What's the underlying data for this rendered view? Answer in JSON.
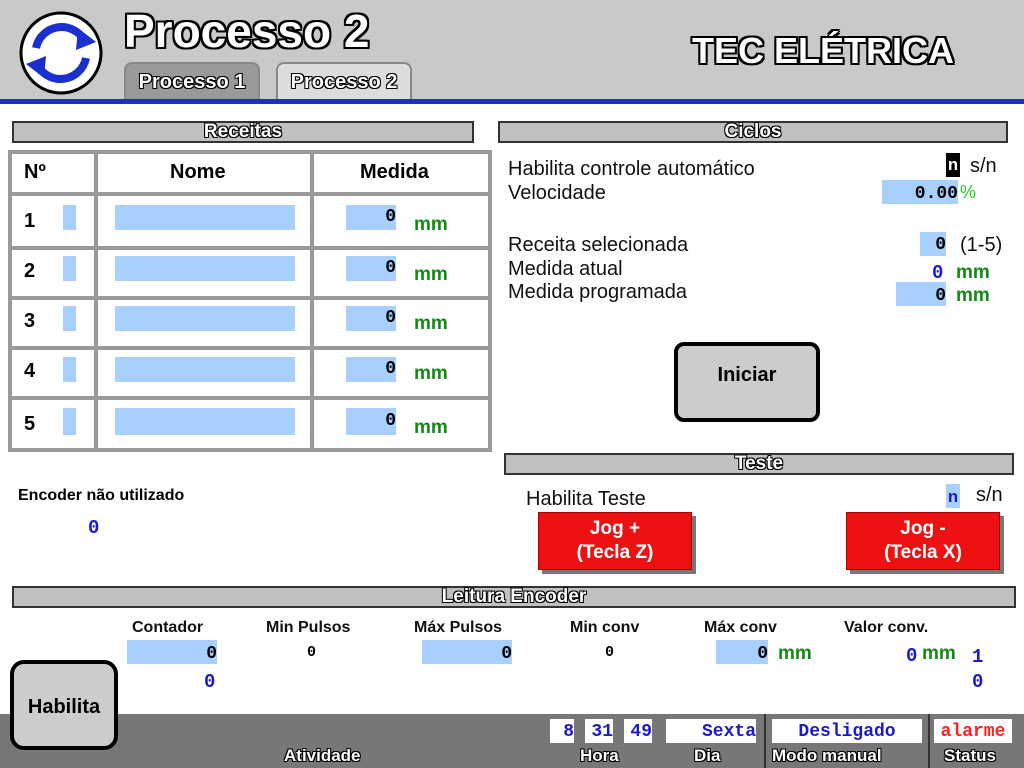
{
  "header": {
    "title": "Processo 2",
    "company": "TEC ELÉTRICA",
    "tabs": [
      {
        "label": "Processo 1"
      },
      {
        "label": "Processo 2"
      }
    ]
  },
  "receitas": {
    "section_title": "Receitas",
    "col_num": "Nº",
    "col_nome": "Nome",
    "col_medida": "Medida",
    "unit": "mm",
    "rows": [
      {
        "num": "1",
        "medida": "0"
      },
      {
        "num": "2",
        "medida": "0"
      },
      {
        "num": "3",
        "medida": "0"
      },
      {
        "num": "4",
        "medida": "0"
      },
      {
        "num": "5",
        "medida": "0"
      }
    ]
  },
  "ciclos": {
    "section_title": "Ciclos",
    "habilita_label": "Habilita controle automático",
    "habilita_value": "n",
    "habilita_suffix": "s/n",
    "velocidade_label": "Velocidade",
    "velocidade_value": "0.00",
    "velocidade_unit": "%",
    "receita_label": "Receita selecionada",
    "receita_value": "0",
    "receita_range": "(1-5)",
    "medida_atual_label": "Medida atual",
    "medida_atual_value": "0",
    "medida_prog_label": "Medida programada",
    "medida_prog_value": "0",
    "unit": "mm",
    "iniciar_label": "Iniciar"
  },
  "teste": {
    "section_title": "Teste",
    "habilita_label": "Habilita Teste",
    "habilita_value": "n",
    "habilita_suffix": "s/n",
    "jog_plus_line1": "Jog +",
    "jog_plus_line2": "(Tecla Z)",
    "jog_minus_line1": "Jog -",
    "jog_minus_line2": "(Tecla X)"
  },
  "encoder": {
    "note_label": "Encoder não utilizado",
    "note_value": "0",
    "section_title": "Leitura Encoder",
    "contador_label": "Contador",
    "contador_value": "0",
    "contador_value2": "0",
    "min_pulsos_label": "Min Pulsos",
    "min_pulsos_value": "0",
    "max_pulsos_label": "Máx Pulsos",
    "max_pulsos_value": "0",
    "min_conv_label": "Min conv",
    "min_conv_value": "0",
    "max_conv_label": "Máx conv",
    "max_conv_value": "0",
    "max_conv_unit": "mm",
    "valor_conv_label": "Valor conv.",
    "valor_conv_value": "0",
    "valor_conv_unit": "mm",
    "valor_conv_extra1": "1",
    "valor_conv_extra2": "0",
    "habilita_label": "Habilita"
  },
  "footer": {
    "atividade_label": "Atividade",
    "hora_h": "8",
    "hora_m": "31",
    "hora_s": "49",
    "hora_label": "Hora",
    "dia_value": "Sexta",
    "dia_label": "Dia",
    "modo_value": "Desligado",
    "modo_label": "Modo manual",
    "status_value": "alarme",
    "status_label": "Status"
  },
  "colors": {
    "header_bg": "#c9c9c9",
    "accent_blue": "#1a2fd0",
    "field_blue": "#a8d0ff",
    "unit_green": "#138b13",
    "button_red": "#ee1111",
    "alarm_red": "#ff2222"
  }
}
